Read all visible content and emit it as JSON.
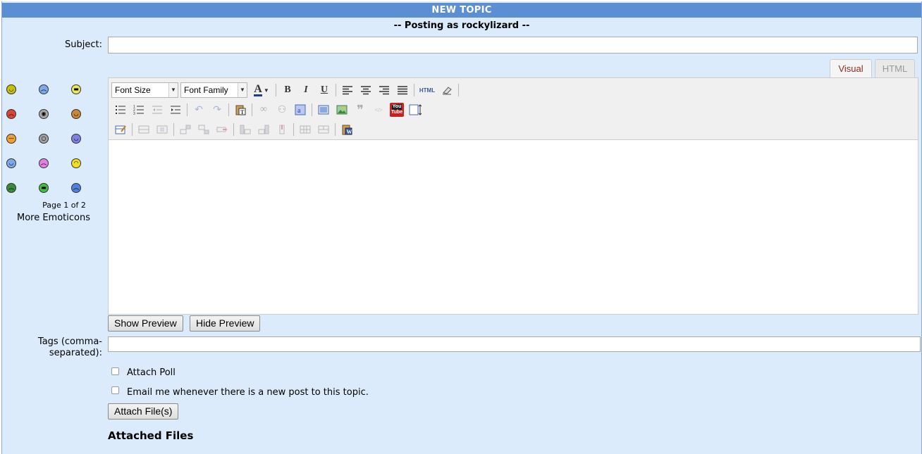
{
  "header": {
    "title": "NEW TOPIC",
    "posting_as": "-- Posting as rockylizard --"
  },
  "subject": {
    "label": "Subject:",
    "value": ""
  },
  "editor_tabs": [
    {
      "label": "Visual",
      "active": true
    },
    {
      "label": "HTML",
      "active": false
    }
  ],
  "toolbar": {
    "font_size": "Font Size",
    "font_family": "Font Family",
    "row1": [
      "font-color-icon",
      "bold-icon",
      "italic-icon",
      "underline-icon",
      "align-left-icon",
      "align-center-icon",
      "align-right-icon",
      "align-justify-icon",
      "html-icon",
      "eraser-icon"
    ],
    "row2": [
      "bullet-list-icon",
      "numbered-list-icon",
      "outdent-icon",
      "indent-icon",
      "undo-icon",
      "redo-icon",
      "paste-text-icon",
      "link-icon",
      "unlink-icon",
      "anchor-icon",
      "image-icon",
      "insert-image-icon",
      "blockquote-icon",
      "code-icon",
      "youtube-icon",
      "fullscreen-icon"
    ],
    "row3": [
      "edit-table-icon",
      "table-row-icon",
      "table-cell-icon",
      "insert-row-before-icon",
      "insert-row-after-icon",
      "delete-row-icon",
      "insert-col-before-icon",
      "insert-col-after-icon",
      "delete-col-icon",
      "split-cells-icon",
      "merge-cells-icon",
      "paste-word-icon"
    ],
    "bold_glyph": "B",
    "italic_glyph": "I",
    "underline_glyph": "U",
    "font_color_glyph": "A",
    "html_glyph": "HTML",
    "youtube_glyph_top": "You",
    "youtube_glyph_bottom": "Tube"
  },
  "emoticons": {
    "page_info": "Page 1 of 2",
    "more_link": "More Emoticons",
    "items": [
      "grin",
      "sad",
      "laugh",
      "angry",
      "cool",
      "tongue",
      "neutral",
      "shocked",
      "wink-purple",
      "blue-smile",
      "pink-sad",
      "yellow-wink",
      "sick",
      "green-grin",
      "cry"
    ],
    "colors": [
      "#c8c000",
      "#7fa8e8",
      "#e8e85a",
      "#d9453a",
      "#a8a8a8",
      "#c8883a",
      "#f0a030",
      "#a0a0a0",
      "#8080e8",
      "#80a8e8",
      "#e080e0",
      "#f0e020",
      "#3a8a3a",
      "#40c040",
      "#5080e0"
    ]
  },
  "buttons": {
    "show_preview": "Show Preview",
    "hide_preview": "Hide Preview",
    "attach_files": "Attach File(s)"
  },
  "tags": {
    "label_line1": "Tags (comma-",
    "label_line2": "separated):",
    "value": ""
  },
  "options": {
    "attach_poll": "Attach Poll",
    "email_me": "Email me whenever there is a new post to this topic."
  },
  "attached_files_heading": "Attached Files",
  "colors": {
    "header_bar": "#5b8fd1",
    "page_background": "#dcebfb",
    "active_tab_text": "#8a2b1f"
  }
}
